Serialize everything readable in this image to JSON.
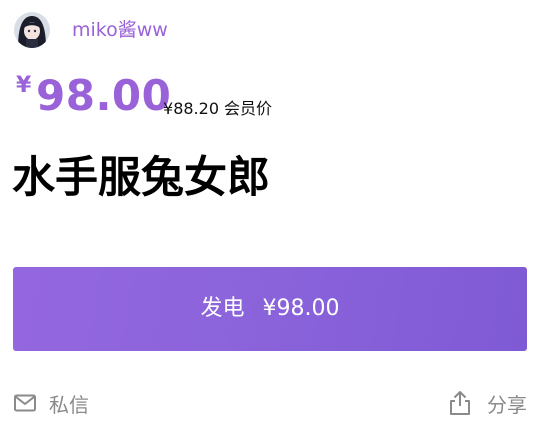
{
  "author": {
    "name": "miko酱ww",
    "avatar_icon": "avatar-image",
    "accent_color": "#9a62d8"
  },
  "price": {
    "currency_symbol": "¥",
    "amount": "98.00",
    "member_currency_symbol": "¥",
    "member_amount": "88.20",
    "member_label": "会员价"
  },
  "plan": {
    "title": "水手服兔女郎"
  },
  "support_button": {
    "label": "发电",
    "price_text": "¥98.00",
    "gradient_start": "#9467e0",
    "gradient_end": "#7f5ad5"
  },
  "footer": {
    "message_label": "私信",
    "message_icon": "mail-icon",
    "share_label": "分享",
    "share_icon": "share-icon",
    "color": "#8a8a8a"
  }
}
